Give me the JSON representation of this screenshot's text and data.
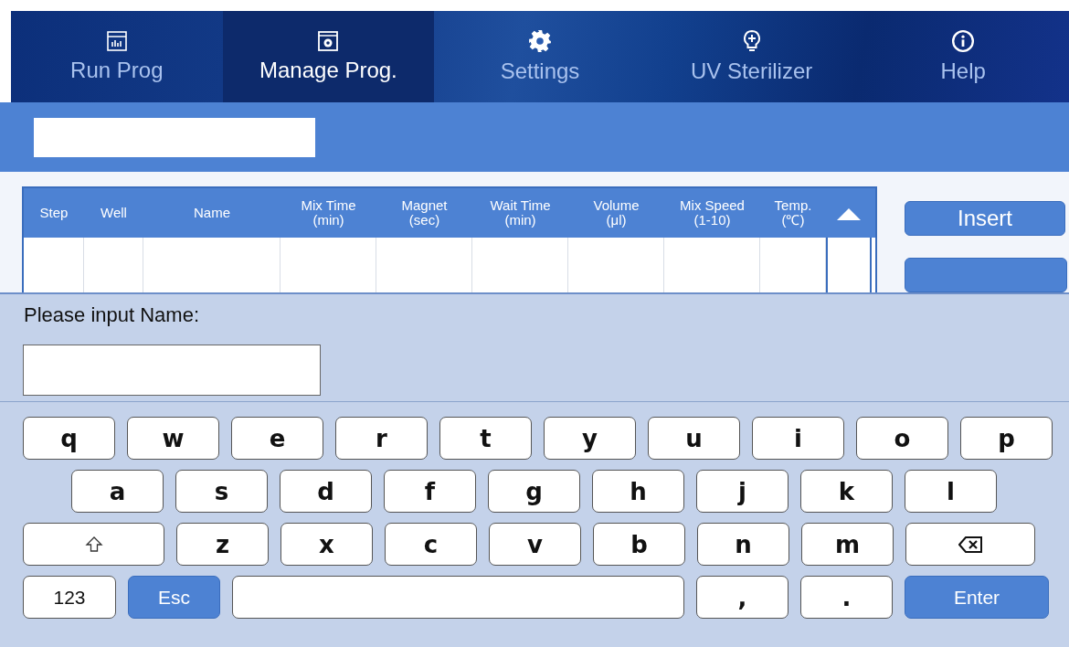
{
  "tabs": [
    {
      "label": "Run Prog",
      "selected": false
    },
    {
      "label": "Manage Prog.",
      "selected": true
    },
    {
      "label": "Settings",
      "selected": false
    },
    {
      "label": "UV Sterilizer",
      "selected": false
    },
    {
      "label": "Help",
      "selected": false
    }
  ],
  "table": {
    "columns": [
      {
        "label": "Step"
      },
      {
        "label": "Well"
      },
      {
        "label": "Name"
      },
      {
        "label": "Mix Time",
        "unit": "(min)"
      },
      {
        "label": "Magnet",
        "unit": "(sec)"
      },
      {
        "label": "Wait Time",
        "unit": "(min)"
      },
      {
        "label": "Volume",
        "unit": "(μl)"
      },
      {
        "label": "Mix Speed",
        "unit": "(1-10)"
      },
      {
        "label": "Temp.",
        "unit": "(℃)"
      }
    ]
  },
  "side_buttons": [
    "Insert"
  ],
  "input_dialog": {
    "prompt": "Please input Name:"
  },
  "keyboard": {
    "rows": [
      {
        "keys": [
          {
            "kind": "char",
            "label": "q"
          },
          {
            "kind": "char",
            "label": "w"
          },
          {
            "kind": "char",
            "label": "e"
          },
          {
            "kind": "char",
            "label": "r"
          },
          {
            "kind": "char",
            "label": "t"
          },
          {
            "kind": "char",
            "label": "y"
          },
          {
            "kind": "char",
            "label": "u"
          },
          {
            "kind": "char",
            "label": "i"
          },
          {
            "kind": "char",
            "label": "o"
          },
          {
            "kind": "char",
            "label": "p"
          }
        ]
      },
      {
        "keys": [
          {
            "kind": "char",
            "label": "a"
          },
          {
            "kind": "char",
            "label": "s"
          },
          {
            "kind": "char",
            "label": "d"
          },
          {
            "kind": "char",
            "label": "f"
          },
          {
            "kind": "char",
            "label": "g"
          },
          {
            "kind": "char",
            "label": "h"
          },
          {
            "kind": "char",
            "label": "j"
          },
          {
            "kind": "char",
            "label": "k"
          },
          {
            "kind": "char",
            "label": "l"
          }
        ]
      },
      {
        "keys": [
          {
            "kind": "shift"
          },
          {
            "kind": "char",
            "label": "z"
          },
          {
            "kind": "char",
            "label": "x"
          },
          {
            "kind": "char",
            "label": "c"
          },
          {
            "kind": "char",
            "label": "v"
          },
          {
            "kind": "char",
            "label": "b"
          },
          {
            "kind": "char",
            "label": "n"
          },
          {
            "kind": "char",
            "label": "m"
          },
          {
            "kind": "backspace"
          }
        ]
      },
      {
        "keys": [
          {
            "kind": "mode",
            "label": "123"
          },
          {
            "kind": "esc",
            "label": "Esc"
          },
          {
            "kind": "space"
          },
          {
            "kind": "char",
            "label": ","
          },
          {
            "kind": "char",
            "label": "."
          },
          {
            "kind": "enter",
            "label": "Enter"
          }
        ]
      }
    ]
  }
}
